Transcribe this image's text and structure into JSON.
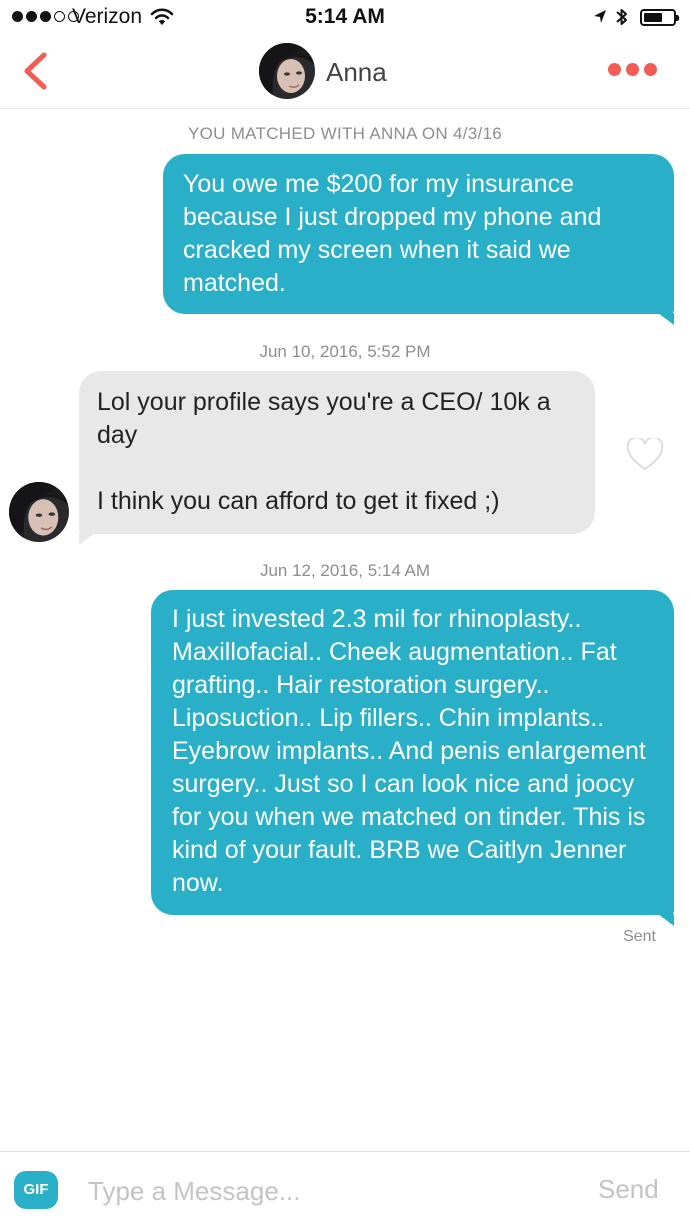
{
  "status_bar": {
    "carrier": "Verizon",
    "time": "5:14 AM",
    "signal_bars_filled": 3,
    "signal_bars_total": 5
  },
  "header": {
    "contact_name": "Anna",
    "back_icon": "chevron-left-icon",
    "more_icon": "more-dots-icon",
    "accent_color": "#f25c54"
  },
  "conversation": {
    "match_notice": "YOU MATCHED WITH ANNA ON 4/3/16",
    "messages": [
      {
        "direction": "sent",
        "text": "You owe me $200 for my insurance because I just dropped my phone and cracked my screen when it said we matched."
      },
      {
        "timestamp": "Jun 10, 2016, 5:52 PM"
      },
      {
        "direction": "received",
        "text": "Lol your profile says you're a CEO/ 10k a day\n\nI think you can afford to get it fixed ;)"
      },
      {
        "timestamp": "Jun 12, 2016, 5:14 AM"
      },
      {
        "direction": "sent",
        "text": "I just invested 2.3 mil for rhinoplasty.. Maxillofacial.. Cheek augmentation.. Fat grafting.. Hair restoration surgery.. Liposuction.. Lip fillers.. Chin implants.. Eyebrow implants.. And penis enlargement surgery.. Just so I can look nice and joocy for you when we matched on tinder. This is kind of your fault. BRB we Caitlyn Jenner now."
      }
    ],
    "delivery_status": "Sent"
  },
  "composer": {
    "gif_label": "GIF",
    "placeholder": "Type a Message...",
    "value": "",
    "send_label": "Send"
  },
  "colors": {
    "sent_bubble": "#2aafc8",
    "received_bubble": "#e8e8e8",
    "accent": "#f25c54"
  }
}
